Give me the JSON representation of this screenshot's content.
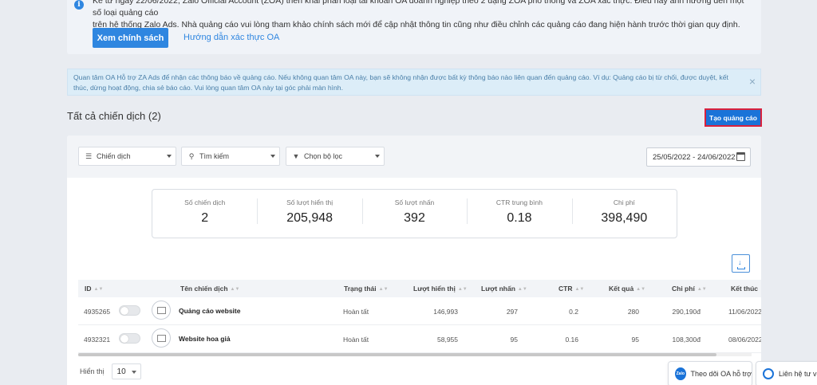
{
  "notice": {
    "line1": "Kể từ ngày 22/06/2022, Zalo Official Account (ZOA) triển khai phân loại tài khoản OA doanh nghiệp theo 2 dạng ZOA phổ thông và ZOA xác thực. Điều này ảnh hưởng đến một số loại quảng cáo",
    "line2": "trên hệ thống Zalo Ads. Nhà quảng cáo vui lòng tham khảo chính sách mới để cập nhật thông tin cũng như điều chỉnh các quảng cáo đang hiện hành trước thời gian quy định.",
    "primary_button": "Xem chính sách",
    "link": "Hướng dẫn xác thực OA"
  },
  "alert": {
    "text": "Quan tâm OA Hỗ trợ ZA Ads để nhận các thông báo về quảng cáo. Nếu không quan tâm OA này, bạn sẽ không nhận được bất kỳ thông báo nào liên quan đến quảng cáo. Ví dụ: Quảng cáo bị từ chối, được duyệt, kết thúc, dừng hoạt động, chia sẻ báo cáo. Vui lòng quan tâm OA này tại góc phải màn hình.",
    "close": "×"
  },
  "page": {
    "title": "Tất cả chiến dịch (2)",
    "create_button": "Tạo quảng cáo"
  },
  "filters": {
    "level": "Chiến dịch",
    "search": "Tìm kiếm",
    "filter": "Chọn bộ lọc",
    "date_range": "25/05/2022 - 24/06/2022"
  },
  "stats": [
    {
      "label": "Số chiến dịch",
      "value": "2"
    },
    {
      "label": "Số lượt hiển thị",
      "value": "205,948"
    },
    {
      "label": "Số lượt nhấn",
      "value": "392"
    },
    {
      "label": "CTR trung bình",
      "value": "0.18"
    },
    {
      "label": "Chi phí",
      "value": "398,490"
    }
  ],
  "table": {
    "headers": [
      "ID",
      "Tên chiến dịch",
      "Trạng thái",
      "Lượt hiển thị",
      "Lượt nhấn",
      "CTR",
      "Kết quả",
      "Chi phí",
      "Kết thúc"
    ],
    "rows": [
      {
        "id": "4935265",
        "name": "Quảng cáo website",
        "status": "Hoàn tất",
        "impressions": "146,993",
        "clicks": "297",
        "ctr": "0.2",
        "results": "280",
        "cost": "290,190đ",
        "end": "11/06/2022"
      },
      {
        "id": "4932321",
        "name": "Website hoa giả",
        "status": "Hoàn tất",
        "impressions": "58,955",
        "clicks": "95",
        "ctr": "0.16",
        "results": "95",
        "cost": "108,300đ",
        "end": "08/06/2022"
      }
    ]
  },
  "pager": {
    "label": "Hiển thị",
    "value": "10"
  },
  "floating": {
    "follow_oa": "Theo dõi OA hỗ trợ",
    "follow_icon_text": "Zalo",
    "contact": "Liên hệ tư vấn"
  }
}
